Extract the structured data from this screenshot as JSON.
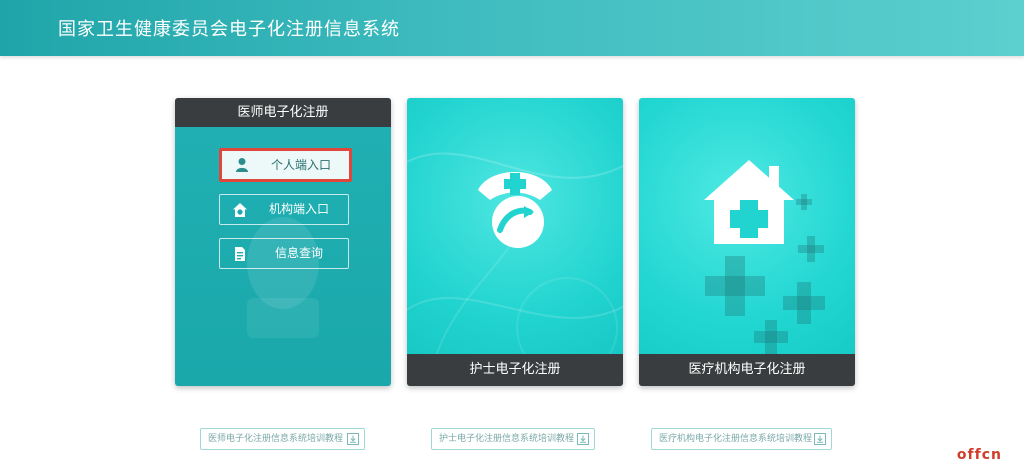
{
  "header": {
    "title": "国家卫生健康委员会电子化注册信息系统"
  },
  "cards": {
    "doctor": {
      "title": "医师电子化注册",
      "buttons": [
        {
          "label": "个人端入口",
          "icon": "person-icon"
        },
        {
          "label": "机构端入口",
          "icon": "home-icon"
        },
        {
          "label": "信息查询",
          "icon": "document-icon"
        }
      ]
    },
    "nurse": {
      "title": "护士电子化注册",
      "icon": "nurse-cap-icon"
    },
    "institution": {
      "title": "医疗机构电子化注册",
      "icon": "hospital-icon"
    }
  },
  "downloads": [
    {
      "label": "医师电子化注册信息系统培训教程"
    },
    {
      "label": "护士电子化注册信息系统培训教程"
    },
    {
      "label": "医疗机构电子化注册信息系统培训教程"
    }
  ],
  "watermark": "offcn",
  "colors": {
    "header": "#2fb3b6",
    "card_dark": "#3a3d3f",
    "highlight": "#e0463a",
    "teal": "#22d4d0"
  }
}
